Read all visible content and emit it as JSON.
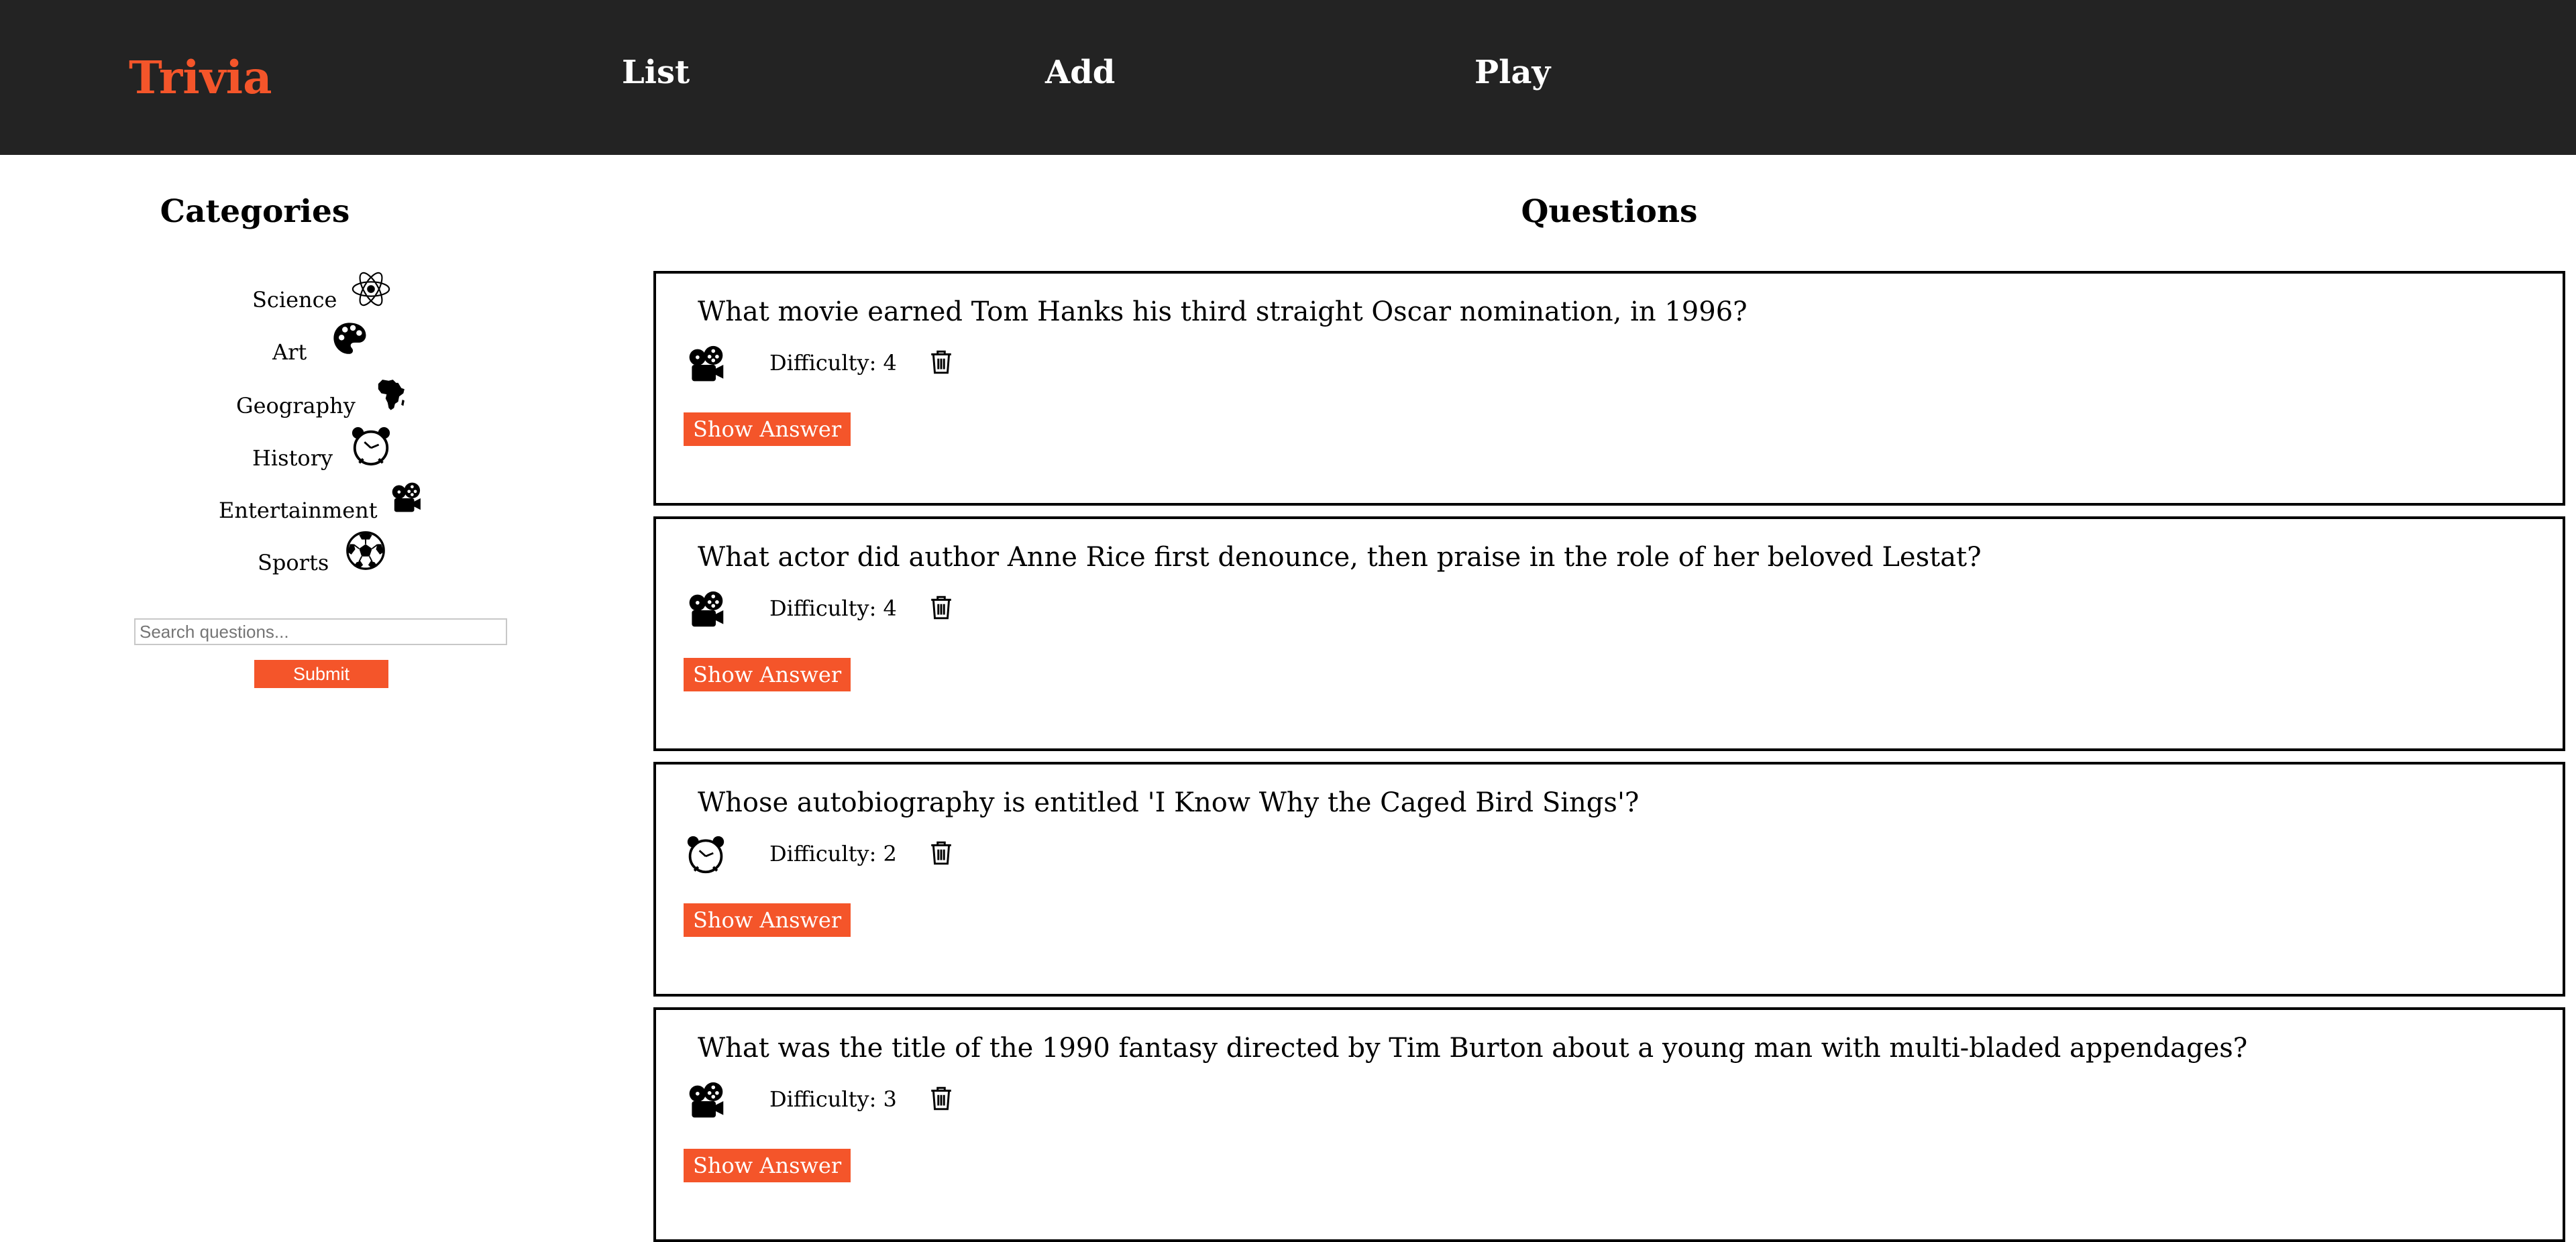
{
  "nav": {
    "brand": "Trivia",
    "links": [
      "List",
      "Add",
      "Play"
    ]
  },
  "categories": {
    "title": "Categories",
    "items": [
      {
        "label": "Science",
        "icon": "atom-icon"
      },
      {
        "label": "Art",
        "icon": "palette-icon"
      },
      {
        "label": "Geography",
        "icon": "africa-icon"
      },
      {
        "label": "History",
        "icon": "alarm-clock-icon"
      },
      {
        "label": "Entertainment",
        "icon": "film-camera-icon"
      },
      {
        "label": "Sports",
        "icon": "soccer-ball-icon"
      }
    ]
  },
  "search": {
    "placeholder": "Search questions...",
    "value": "",
    "submit_label": "Submit"
  },
  "questions": {
    "title": "Questions",
    "show_answer_label": "Show Answer",
    "items": [
      {
        "text": "What movie earned Tom Hanks his third straight Oscar nomination, in 1996?",
        "category_icon": "film-camera-icon",
        "difficulty": "Difficulty: 4"
      },
      {
        "text": "What actor did author Anne Rice first denounce, then praise in the role of her beloved Lestat?",
        "category_icon": "film-camera-icon",
        "difficulty": "Difficulty: 4"
      },
      {
        "text": "Whose autobiography is entitled 'I Know Why the Caged Bird Sings'?",
        "category_icon": "alarm-clock-icon",
        "difficulty": "Difficulty: 2"
      },
      {
        "text": "What was the title of the 1990 fantasy directed by Tim Burton about a young man with multi-bladed appendages?",
        "category_icon": "film-camera-icon",
        "difficulty": "Difficulty: 3"
      }
    ]
  },
  "colors": {
    "accent": "#f4552a",
    "navbar": "#232323"
  }
}
